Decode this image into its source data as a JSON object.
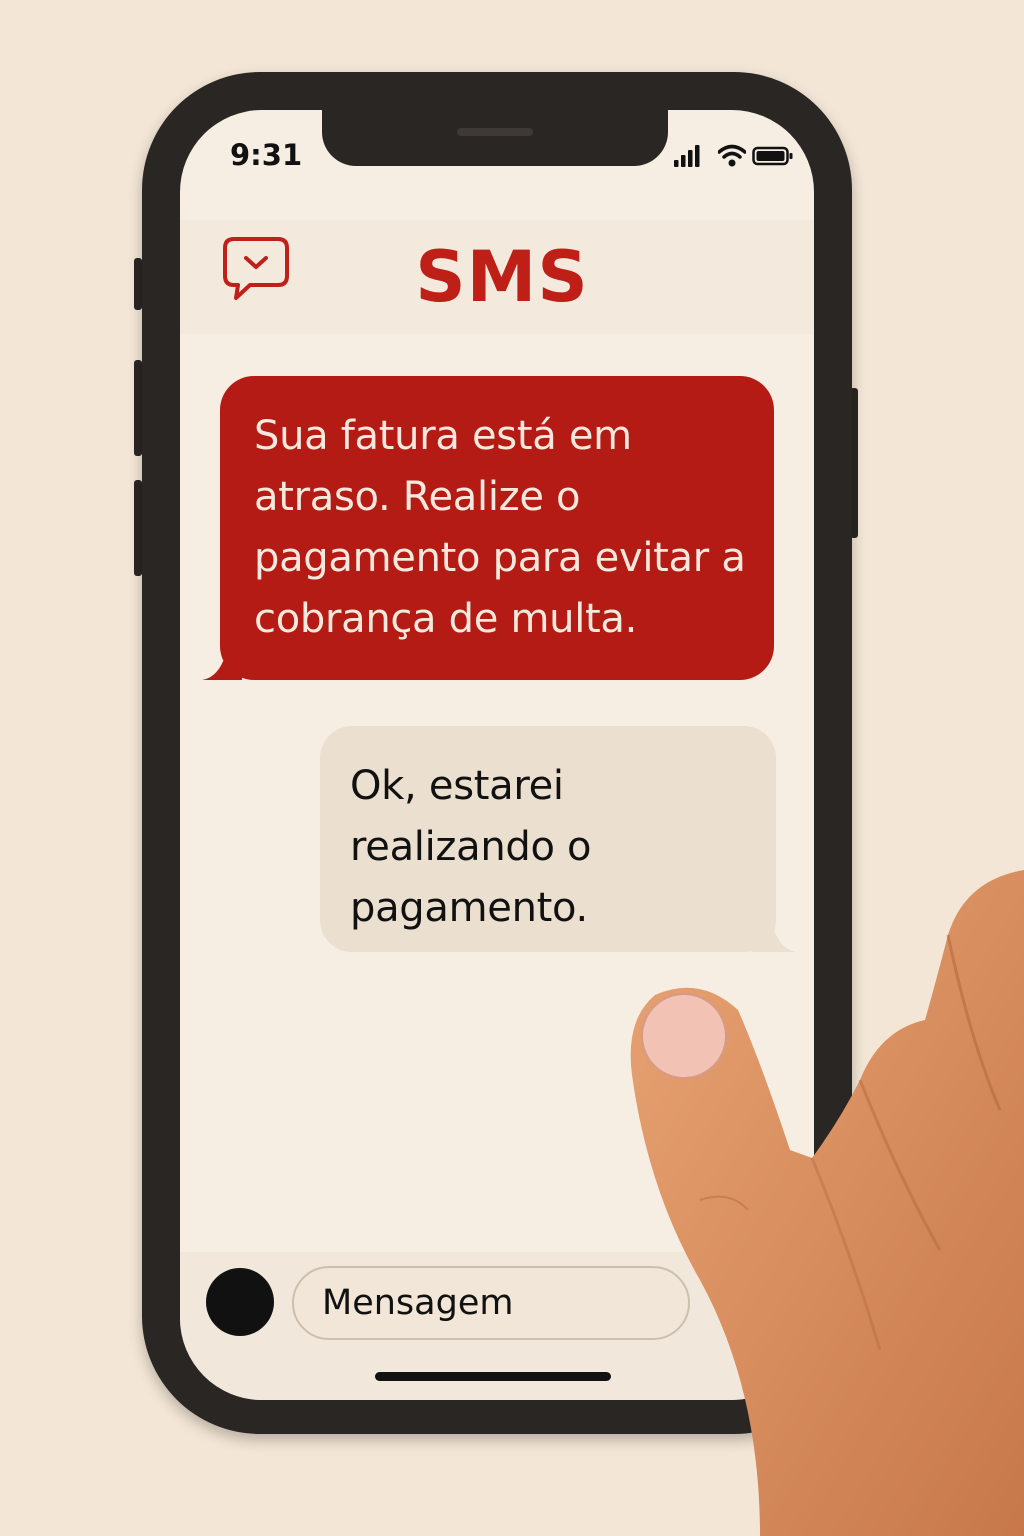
{
  "status_bar": {
    "time": "9:31"
  },
  "header": {
    "title": "SMS",
    "icon": "chat-bubble-chevron-icon"
  },
  "messages": [
    {
      "direction": "incoming",
      "text": "Sua fatura está em atraso. Realize o pagamento para evitar a cobrança de multa."
    },
    {
      "direction": "outgoing",
      "text": "Ok, estarei realizando o pagamento."
    }
  ],
  "composer": {
    "placeholder": "Mensagem"
  },
  "colors": {
    "accent": "#b41b14",
    "background": "#f6ede3",
    "outgoing_bubble": "#ebdfcf"
  }
}
